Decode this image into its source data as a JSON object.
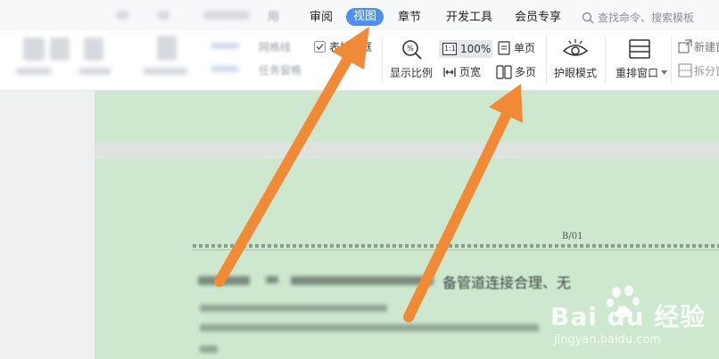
{
  "menu": {
    "tabs": [
      {
        "label": "审阅",
        "active": false
      },
      {
        "label": "视图",
        "active": true
      },
      {
        "label": "章节",
        "active": false
      },
      {
        "label": "开发工具",
        "active": false
      },
      {
        "label": "会员专享",
        "active": false
      }
    ],
    "partial_tab": "用",
    "search_label": "查找命令、搜索模板"
  },
  "ribbon": {
    "gridlines_label": "网格线",
    "table_border_label": "表格虚框",
    "task_pane_label": "任务窗格",
    "zoom_ratio_label": "显示比例",
    "zoom_percent_label": "100%",
    "zoom_badge": "1:1",
    "page_width_label": "页宽",
    "single_page_label": "单页",
    "multi_page_label": "多页",
    "eye_protection_label": "护眼模式",
    "rearrange_window_label": "重排窗口",
    "new_window_label": "新建窗",
    "split_window_label": "拆分窗"
  },
  "document": {
    "page_number": "B/01",
    "visible_text": "备管道连接合理、无"
  },
  "watermark": {
    "brand": "Bai du 经验",
    "url": "jingyan.baidu.com"
  },
  "colors": {
    "accent": "#4d8ef0",
    "doc_background": "#cde8cf",
    "arrow": "#f08a36"
  }
}
